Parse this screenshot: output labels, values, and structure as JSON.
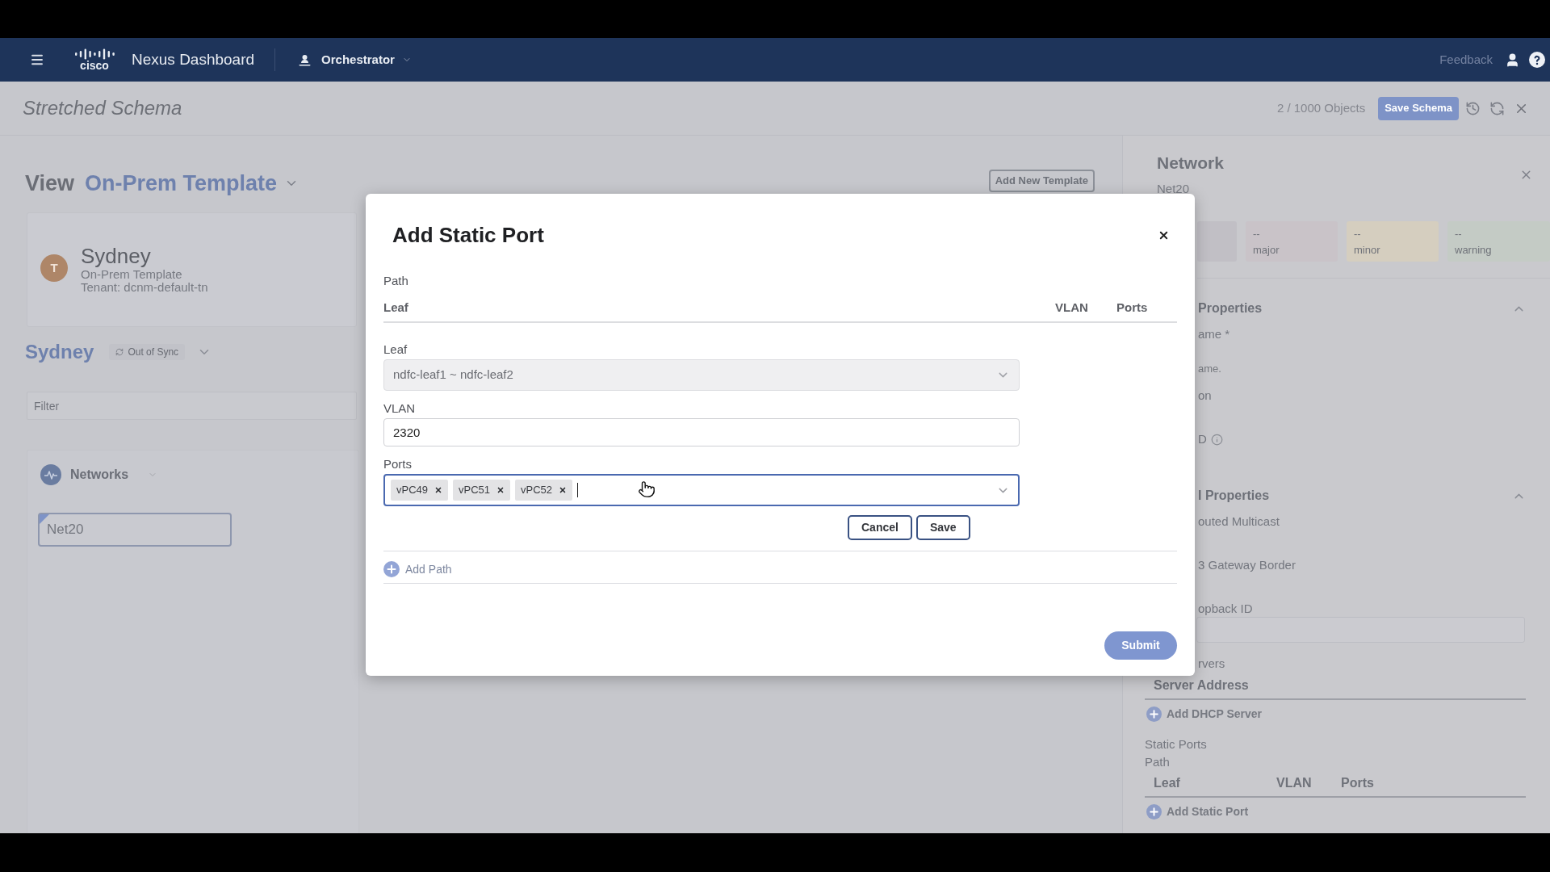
{
  "header": {
    "logo_text": "cisco",
    "app_title": "Nexus Dashboard",
    "service": "Orchestrator",
    "feedback": "Feedback"
  },
  "schema_bar": {
    "title": "Stretched Schema",
    "object_count": "2 / 1000 Objects",
    "save_button": "Save Schema"
  },
  "left_pane": {
    "view_label": "View",
    "template": "On-Prem Template",
    "template_card": {
      "avatar": "T",
      "site": "Sydney",
      "template": "On-Prem Template",
      "tenant": "Tenant: dcnm-default-tn"
    },
    "site": {
      "name": "Sydney",
      "status": "Out of Sync"
    },
    "filter": {
      "placeholder": "Filter"
    },
    "networks": {
      "label": "Networks",
      "items": [
        {
          "name": "Net20",
          "selected": true
        }
      ]
    }
  },
  "canvas": {
    "add_template_button": "Add New Template"
  },
  "network_panel": {
    "title": "Network",
    "subtitle": "Net20",
    "severity_tiles": [
      {
        "value": "--",
        "label": "major",
        "color": "#c9c3c8"
      },
      {
        "value": "--",
        "label": "minor",
        "color": "#d5cebf"
      },
      {
        "value": "--",
        "label": "warning",
        "color": "#c4cbc5"
      }
    ],
    "sections": [
      {
        "title": "Properties",
        "expanded": true,
        "items": [
          {
            "kind": "label",
            "text": "ame *"
          },
          {
            "kind": "hint",
            "text": "ame."
          },
          {
            "kind": "label",
            "text": "on"
          },
          {
            "kind": "info_label",
            "text": "D"
          }
        ]
      },
      {
        "title": "l Properties",
        "expanded": true,
        "items": [
          {
            "kind": "label",
            "text": "outed Multicast"
          },
          {
            "kind": "label",
            "text": "3 Gateway Border"
          },
          {
            "kind": "label",
            "text": "opback ID"
          },
          {
            "kind": "input"
          },
          {
            "kind": "label",
            "text": "rvers"
          }
        ]
      }
    ],
    "dhcp_servers": {
      "columns": [
        "Server Address"
      ],
      "add_link": "Add DHCP Server"
    },
    "static_ports": {
      "title": "Static Ports",
      "path_label": "Path",
      "columns": [
        "Leaf",
        "VLAN",
        "Ports"
      ],
      "add_link": "Add Static Port"
    }
  },
  "modal": {
    "title": "Add Static Port",
    "path_label": "Path",
    "columns": [
      "Leaf",
      "VLAN",
      "Ports"
    ],
    "form": {
      "leaf": {
        "label": "Leaf",
        "value": "ndfc-leaf1 ~ ndfc-leaf2",
        "disabled": true
      },
      "vlan": {
        "label": "VLAN",
        "value": "2320"
      },
      "ports": {
        "label": "Ports",
        "focused": true,
        "chips": [
          "vPC49",
          "vPC51",
          "vPC52"
        ]
      },
      "buttons": [
        "Cancel",
        "Save"
      ]
    },
    "add_path": "Add Path",
    "submit": {
      "label": "Submit",
      "disabled": true
    }
  }
}
